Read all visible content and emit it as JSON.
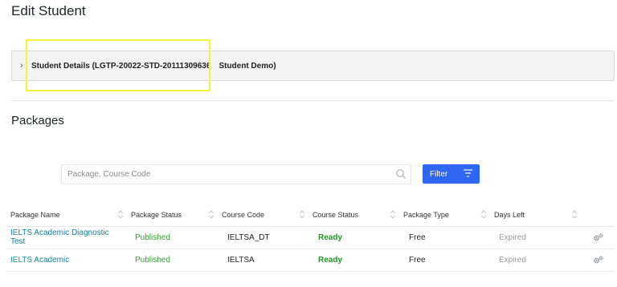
{
  "page": {
    "title": "Edit Student"
  },
  "student_details": {
    "label": "Student Details (LGTP-20022-STD-20111309636",
    "name": "Student Demo)"
  },
  "packages": {
    "title": "Packages",
    "search": {
      "placeholder": "Package, Course Code",
      "value": ""
    },
    "filter_label": "Filter",
    "columns": [
      "Package Name",
      "Package Status",
      "Course Code",
      "Course Status",
      "Package Type",
      "Days Left"
    ],
    "rows": [
      {
        "name": "IELTS Academic Diagnostic Test",
        "status": "Published",
        "code": "IELTSA_DT",
        "course_status": "Ready",
        "type": "Free",
        "days_left": "Expired"
      },
      {
        "name": "IELTS Academic",
        "status": "Published",
        "code": "IELTSA",
        "course_status": "Ready",
        "type": "Free",
        "days_left": "Expired"
      }
    ]
  },
  "colors": {
    "accent": "#2e66f0",
    "link": "#17829a",
    "published": "#2aa22a",
    "highlight": "#f4f53a"
  }
}
